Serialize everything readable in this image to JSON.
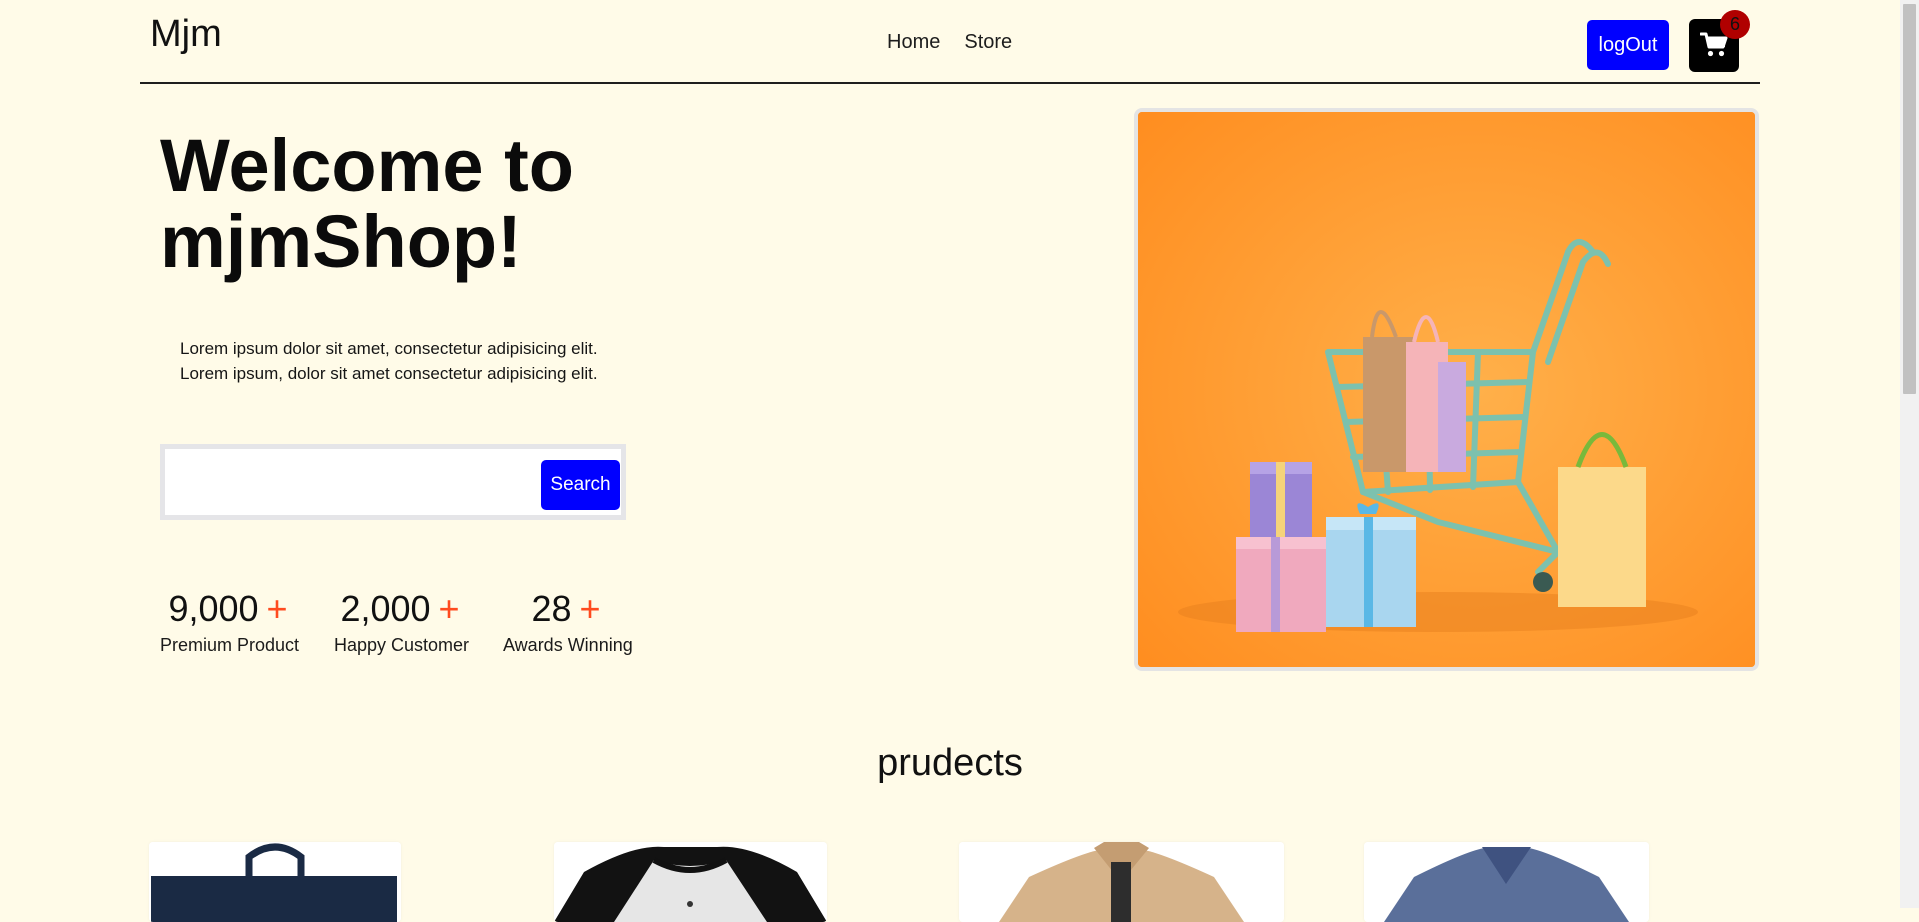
{
  "header": {
    "logo": "Mjm",
    "nav": [
      {
        "label": "Home"
      },
      {
        "label": "Store"
      }
    ],
    "logout_label": "logOut",
    "cart_count": "6"
  },
  "hero": {
    "title_line1": "Welcome to",
    "title_line2": "mjmShop!",
    "description_line1": "Lorem ipsum dolor sit amet, consectetur adipisicing elit.",
    "description_line2": "Lorem ipsum, dolor sit amet consectetur adipisicing elit.",
    "search_placeholder": "",
    "search_label": "Search",
    "stats": [
      {
        "number": "9,000",
        "plus": "+",
        "label": "Premium Product"
      },
      {
        "number": "2,000",
        "plus": "+",
        "label": "Happy Customer"
      },
      {
        "number": "28",
        "plus": "+",
        "label": "Awards Winning"
      }
    ]
  },
  "products": {
    "title": "prudects"
  },
  "colors": {
    "page_bg": "#fffbe8",
    "primary_button": "#0000ff",
    "accent_plus": "#ff4b1f",
    "badge": "#b00000"
  },
  "icons": {
    "cart": "cart-icon"
  }
}
